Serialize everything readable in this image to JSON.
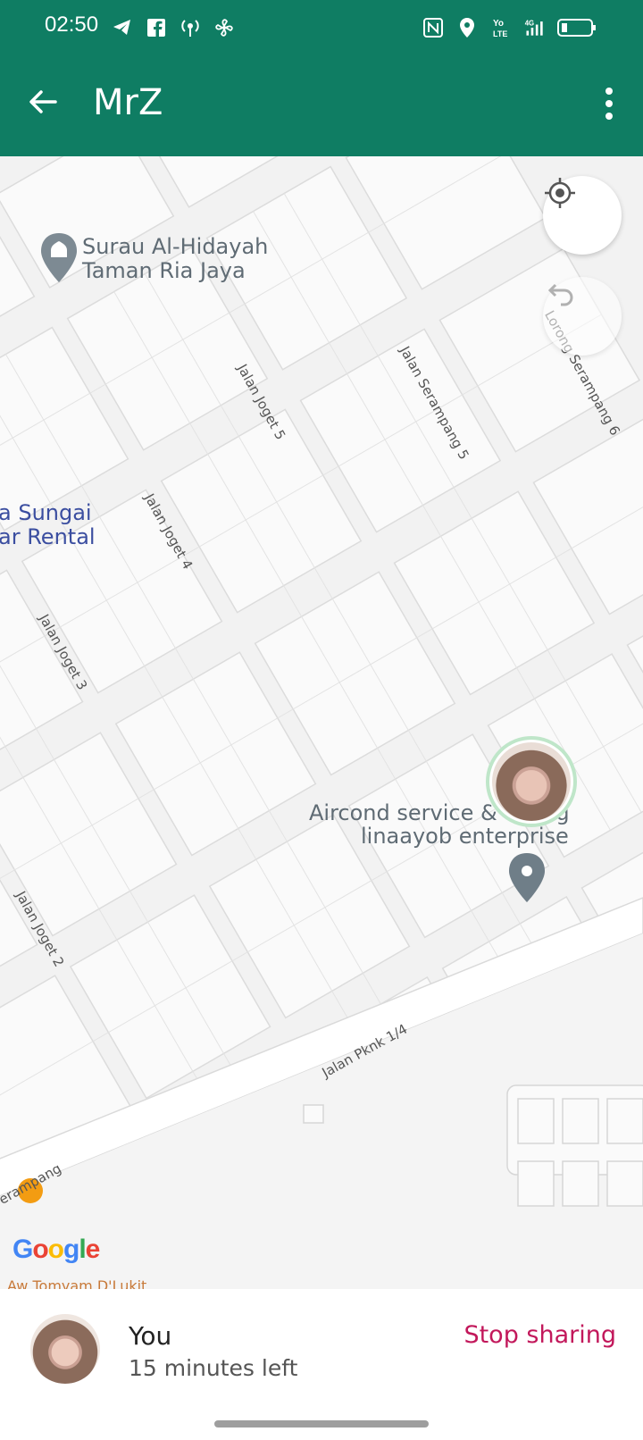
{
  "status_bar": {
    "time": "02:50",
    "left_icons": [
      "telegram-icon",
      "facebook-icon",
      "hotspot-icon",
      "fan-icon"
    ],
    "right_icons": [
      "nfc-icon",
      "location-icon",
      "volte-icon",
      "signal-icon",
      "battery-icon"
    ],
    "network": "4G"
  },
  "header": {
    "title": "MrZ",
    "back_icon": "arrow-left-icon",
    "menu_icon": "more-vert-icon",
    "color": "#0f7d63"
  },
  "map": {
    "poi_surau": "Surau Al-Hidayah\nTaman Ria Jaya",
    "poi_aircond_line1": "Aircond service & wiring",
    "poi_aircond_line2": "linaayob enterprise",
    "partial_label_line1": "a Sungai",
    "partial_label_line2": "ar Rental",
    "streets": {
      "joget5": "Jalan Joget 5",
      "serampang5": "Jalan Serampang 5",
      "serampang6": "Lorong Serampang 6",
      "joget4": "Jalan Joget 4",
      "joget3": "Jalan Joget 3",
      "joget2": "Jalan Joget 2",
      "pknk": "Jalan Pknk 1/4",
      "serampang_bottom": "erampang"
    },
    "bottom_partial": "Aw Tomyam D'Lukit",
    "google": "Google"
  },
  "fabs": {
    "recenter_icon": "my-location-icon",
    "undo_icon": "undo-icon"
  },
  "sharing": {
    "name": "You",
    "remaining": "15 minutes left",
    "stop_label": "Stop sharing",
    "stop_color": "#c2185b"
  }
}
